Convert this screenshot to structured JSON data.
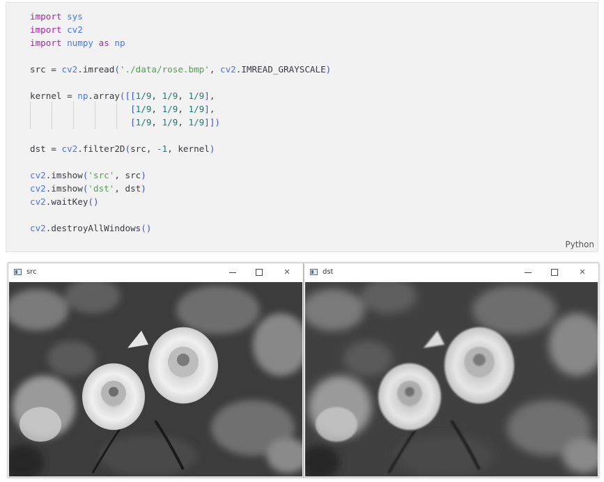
{
  "code": {
    "language": "Python",
    "lines": [
      [
        [
          "kw",
          "import"
        ],
        [
          "pl",
          " "
        ],
        [
          "mod",
          "sys"
        ]
      ],
      [
        [
          "kw",
          "import"
        ],
        [
          "pl",
          " "
        ],
        [
          "mod",
          "cv2"
        ]
      ],
      [
        [
          "kw",
          "import"
        ],
        [
          "pl",
          " "
        ],
        [
          "mod",
          "numpy"
        ],
        [
          "pl",
          " "
        ],
        [
          "kw",
          "as"
        ],
        [
          "pl",
          " "
        ],
        [
          "mod",
          "np"
        ]
      ],
      [],
      [
        [
          "pl",
          "src = "
        ],
        [
          "mod",
          "cv2"
        ],
        [
          "pl",
          "."
        ],
        [
          "pl",
          "imread"
        ],
        [
          "br",
          "("
        ],
        [
          "str",
          "'./data/rose.bmp'"
        ],
        [
          "pl",
          ", "
        ],
        [
          "mod",
          "cv2"
        ],
        [
          "pl",
          ".IMREAD_GRAYSCALE"
        ],
        [
          "br",
          ")"
        ]
      ],
      [],
      [
        [
          "pl",
          "kernel = "
        ],
        [
          "mod",
          "np"
        ],
        [
          "pl",
          ".array"
        ],
        [
          "br",
          "([["
        ],
        [
          "num",
          "1/9"
        ],
        [
          "pl",
          ", "
        ],
        [
          "num",
          "1/9"
        ],
        [
          "pl",
          ", "
        ],
        [
          "num",
          "1/9"
        ],
        [
          "br",
          "]"
        ],
        [
          "pl",
          ","
        ]
      ],
      [
        [
          "pl",
          "                   "
        ],
        [
          "br",
          "["
        ],
        [
          "num",
          "1/9"
        ],
        [
          "pl",
          ", "
        ],
        [
          "num",
          "1/9"
        ],
        [
          "pl",
          ", "
        ],
        [
          "num",
          "1/9"
        ],
        [
          "br",
          "]"
        ],
        [
          "pl",
          ","
        ]
      ],
      [
        [
          "pl",
          "                   "
        ],
        [
          "br",
          "["
        ],
        [
          "num",
          "1/9"
        ],
        [
          "pl",
          ", "
        ],
        [
          "num",
          "1/9"
        ],
        [
          "pl",
          ", "
        ],
        [
          "num",
          "1/9"
        ],
        [
          "br",
          "]])"
        ]
      ],
      [],
      [
        [
          "pl",
          "dst = "
        ],
        [
          "mod",
          "cv2"
        ],
        [
          "pl",
          ".filter2D"
        ],
        [
          "br",
          "("
        ],
        [
          "pl",
          "src, "
        ],
        [
          "num",
          "-1"
        ],
        [
          "pl",
          ", kernel"
        ],
        [
          "br",
          ")"
        ]
      ],
      [],
      [
        [
          "mod",
          "cv2"
        ],
        [
          "pl",
          ".imshow"
        ],
        [
          "br",
          "("
        ],
        [
          "str",
          "'src'"
        ],
        [
          "pl",
          ", src"
        ],
        [
          "br",
          ")"
        ]
      ],
      [
        [
          "mod",
          "cv2"
        ],
        [
          "pl",
          ".imshow"
        ],
        [
          "br",
          "("
        ],
        [
          "str",
          "'dst'"
        ],
        [
          "pl",
          ", dst"
        ],
        [
          "br",
          ")"
        ]
      ],
      [
        [
          "mod",
          "cv2"
        ],
        [
          "pl",
          ".waitKey"
        ],
        [
          "br",
          "()"
        ]
      ],
      [],
      [
        [
          "mod",
          "cv2"
        ],
        [
          "pl",
          ".destroyAllWindows"
        ],
        [
          "br",
          "()"
        ]
      ]
    ]
  },
  "windows": {
    "src": {
      "title": "src",
      "min_icon": "minimize-icon",
      "max_icon": "maximize-icon",
      "close_icon": "close-icon",
      "close_glyph": "✕"
    },
    "dst": {
      "title": "dst",
      "min_icon": "minimize-icon",
      "max_icon": "maximize-icon",
      "close_icon": "close-icon",
      "close_glyph": "✕"
    }
  },
  "colors": {
    "keyword": "#a626a4",
    "module": "#4078f2",
    "string": "#50a14f",
    "number": "#1b7a74",
    "code_bg": "#f2f2f2"
  }
}
